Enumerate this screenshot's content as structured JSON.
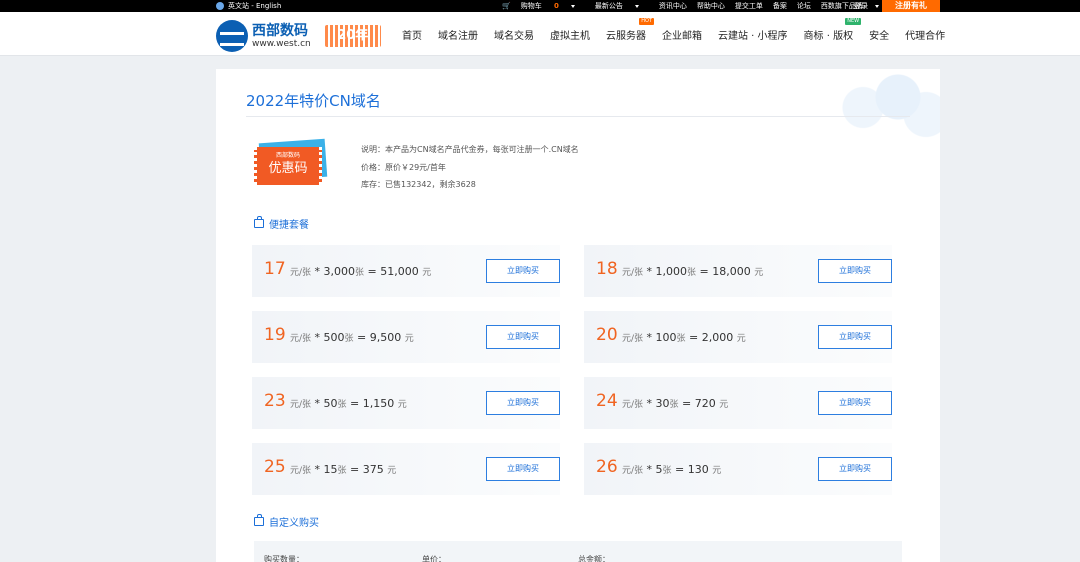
{
  "topbar": {
    "lang": "英文站 - English",
    "cart_label": "购物车",
    "cart_count": "0",
    "announce": "最新公告",
    "news": "资讯中心",
    "help": "帮助中心",
    "ticket": "提交工单",
    "filing": "备案",
    "forum": "论坛",
    "brands": "西数旗下品牌",
    "login": "登录",
    "register": "注册有礼"
  },
  "header": {
    "logo_cn": "西部数码",
    "logo_en": "www.west.cn",
    "anniv": "20年",
    "nav": [
      "首页",
      "域名注册",
      "域名交易",
      "虚拟主机",
      "云服务器",
      "企业邮箱",
      "云建站 · 小程序",
      "商标 · 版权",
      "安全",
      "代理合作"
    ],
    "hot_badge": "HOT",
    "new_badge": "NEW"
  },
  "page": {
    "title": "2022年特价CN域名",
    "coupon_small": "西部数码",
    "coupon_big": "优惠码",
    "desc": "说明：本产品为CN域名产品代金券，每张可注册一个.CN域名",
    "price": "价格：原价￥29元/首年",
    "stock": "库存：已售132342，剩余3628",
    "quick_title": "便捷套餐",
    "custom_title": "自定义购买",
    "custom_qty": "购买数量：",
    "custom_unit": "单价：",
    "custom_total": "总金额："
  },
  "packages": [
    {
      "price": "17",
      "unit": "元/张",
      "qty": "3,000",
      "qty_unit": "张",
      "total": "51,000",
      "currency": "元",
      "buy": "立即购买"
    },
    {
      "price": "18",
      "unit": "元/张",
      "qty": "1,000",
      "qty_unit": "张",
      "total": "18,000",
      "currency": "元",
      "buy": "立即购买"
    },
    {
      "price": "19",
      "unit": "元/张",
      "qty": "500",
      "qty_unit": "张",
      "total": "9,500",
      "currency": "元",
      "buy": "立即购买"
    },
    {
      "price": "20",
      "unit": "元/张",
      "qty": "100",
      "qty_unit": "张",
      "total": "2,000",
      "currency": "元",
      "buy": "立即购买"
    },
    {
      "price": "23",
      "unit": "元/张",
      "qty": "50",
      "qty_unit": "张",
      "total": "1,150",
      "currency": "元",
      "buy": "立即购买"
    },
    {
      "price": "24",
      "unit": "元/张",
      "qty": "30",
      "qty_unit": "张",
      "total": "720",
      "currency": "元",
      "buy": "立即购买"
    },
    {
      "price": "25",
      "unit": "元/张",
      "qty": "15",
      "qty_unit": "张",
      "total": "375",
      "currency": "元",
      "buy": "立即购买"
    },
    {
      "price": "26",
      "unit": "元/张",
      "qty": "5",
      "qty_unit": "张",
      "total": "130",
      "currency": "元",
      "buy": "立即购买"
    }
  ],
  "colors": {
    "accent": "#1c6fd8",
    "price": "#f06421",
    "register": "#ff6a00"
  }
}
